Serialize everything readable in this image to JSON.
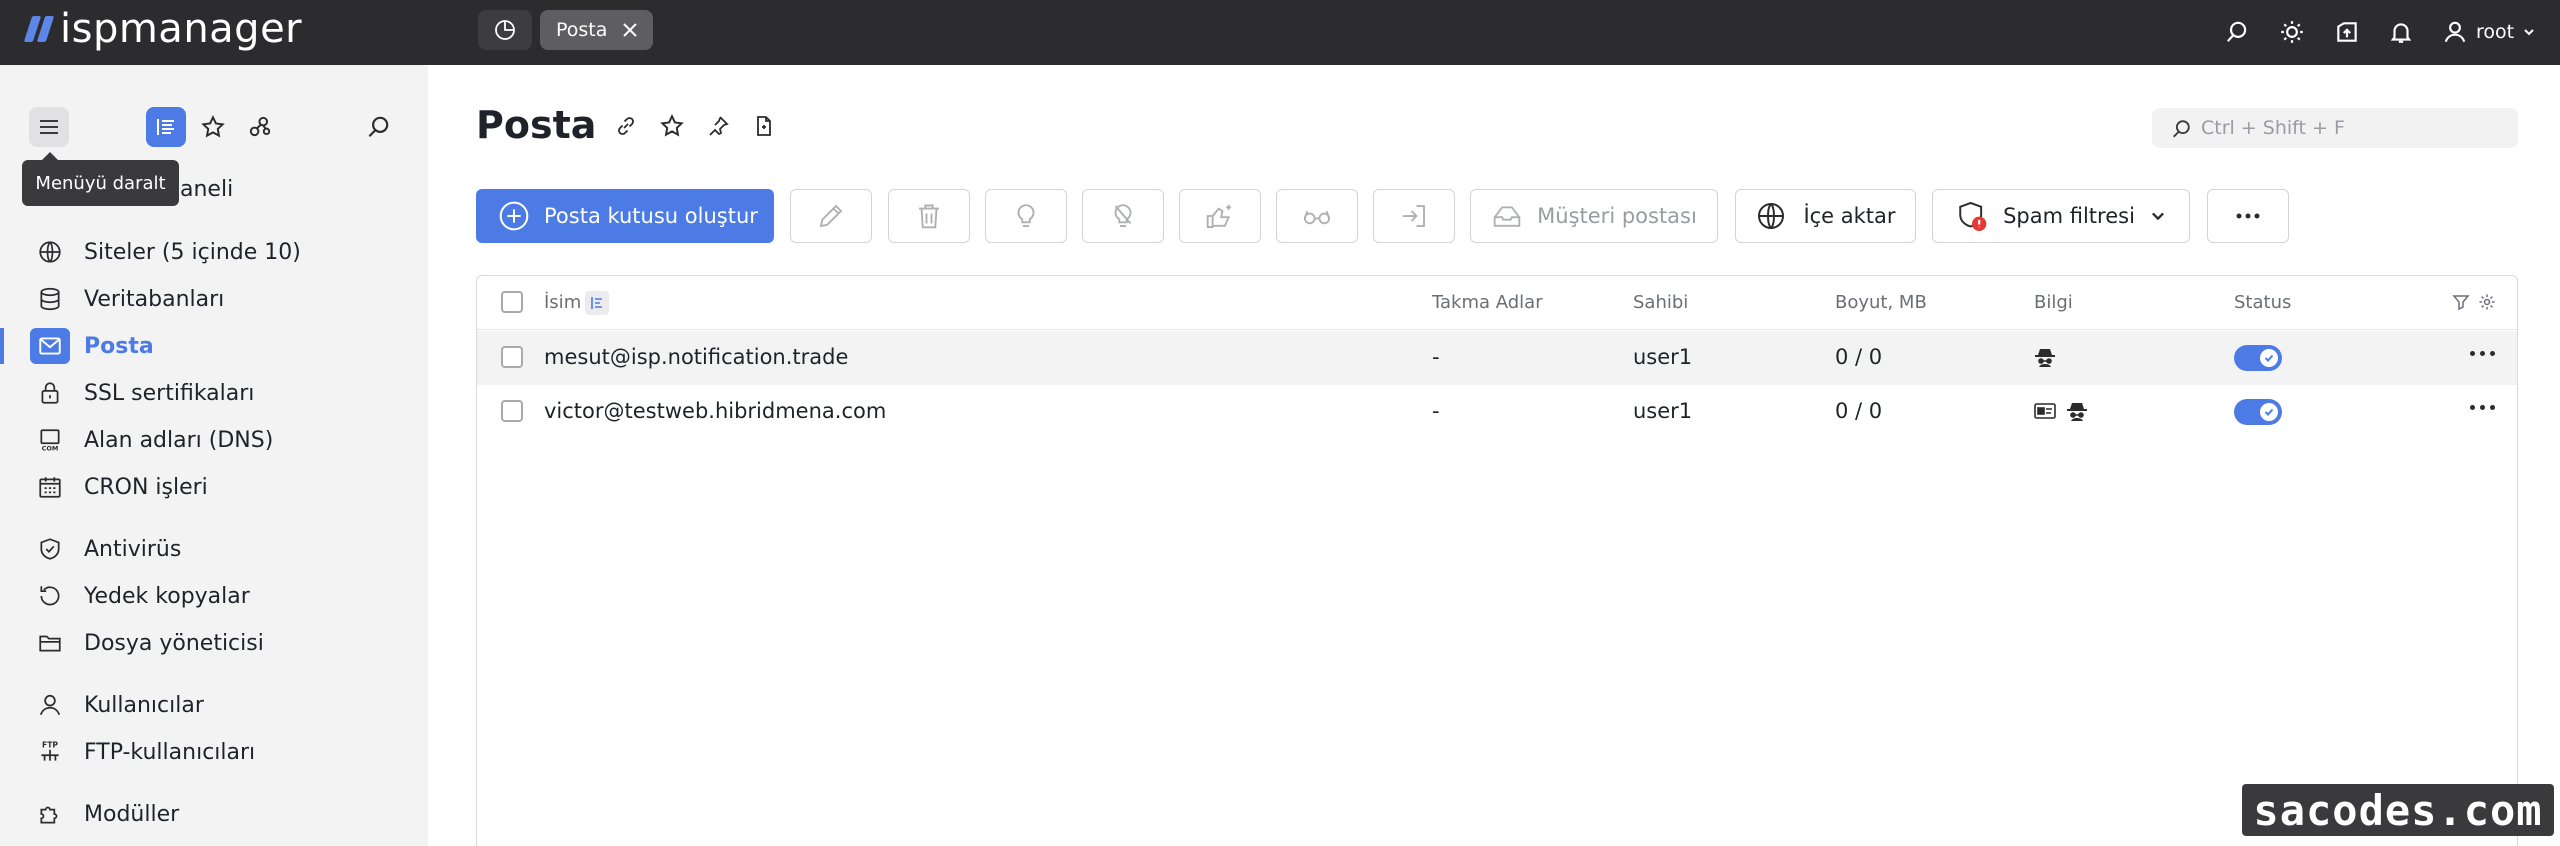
{
  "app": {
    "logo_text": "ispmanager"
  },
  "topbar": {
    "tab_label": "Posta",
    "user_name": "root"
  },
  "sidebar": {
    "tooltip": "Menüyü daralt",
    "partial_item": "aneli",
    "items": [
      {
        "label": "Siteler (5 içinde 10)",
        "icon": "globe-icon"
      },
      {
        "label": "Veritabanları",
        "icon": "database-icon"
      },
      {
        "label": "Posta",
        "icon": "mail-icon",
        "active": true
      },
      {
        "label": "SSL sertifikaları",
        "icon": "lock-icon"
      },
      {
        "label": "Alan adları (DNS)",
        "icon": "dns-icon"
      },
      {
        "label": "CRON işleri",
        "icon": "calendar-icon"
      },
      {
        "label": "Antivirüs",
        "icon": "shield-check-icon"
      },
      {
        "label": "Yedek kopyalar",
        "icon": "backup-icon"
      },
      {
        "label": "Dosya yöneticisi",
        "icon": "folder-icon"
      },
      {
        "label": "Kullanıcılar",
        "icon": "user-icon"
      },
      {
        "label": "FTP-kullanıcıları",
        "icon": "ftp-icon"
      },
      {
        "label": "Modüller",
        "icon": "puzzle-icon"
      }
    ]
  },
  "main": {
    "title": "Posta",
    "search_placeholder": "Ctrl + Shift + F",
    "toolbar": {
      "create_label": "Posta kutusu oluştur",
      "client_mail_label": "Müşteri postası",
      "import_label": "İçe aktar",
      "spam_label": "Spam filtresi"
    },
    "table": {
      "columns": [
        "İsim",
        "Takma Adlar",
        "Sahibi",
        "Boyut, MB",
        "Bilgi",
        "Status"
      ],
      "rows": [
        {
          "name": "mesut@isp.notification.trade",
          "aliases": "-",
          "owner": "user1",
          "size": "0 / 0"
        },
        {
          "name": "victor@testweb.hibridmena.com",
          "aliases": "-",
          "owner": "user1",
          "size": "0 / 0"
        }
      ]
    }
  },
  "watermark": "sacodes.com",
  "colors": {
    "accent": "#4c7be6",
    "topbar": "#2c2c2e",
    "sidebar": "#f3f3f4",
    "spam_badge": "#e53935"
  }
}
